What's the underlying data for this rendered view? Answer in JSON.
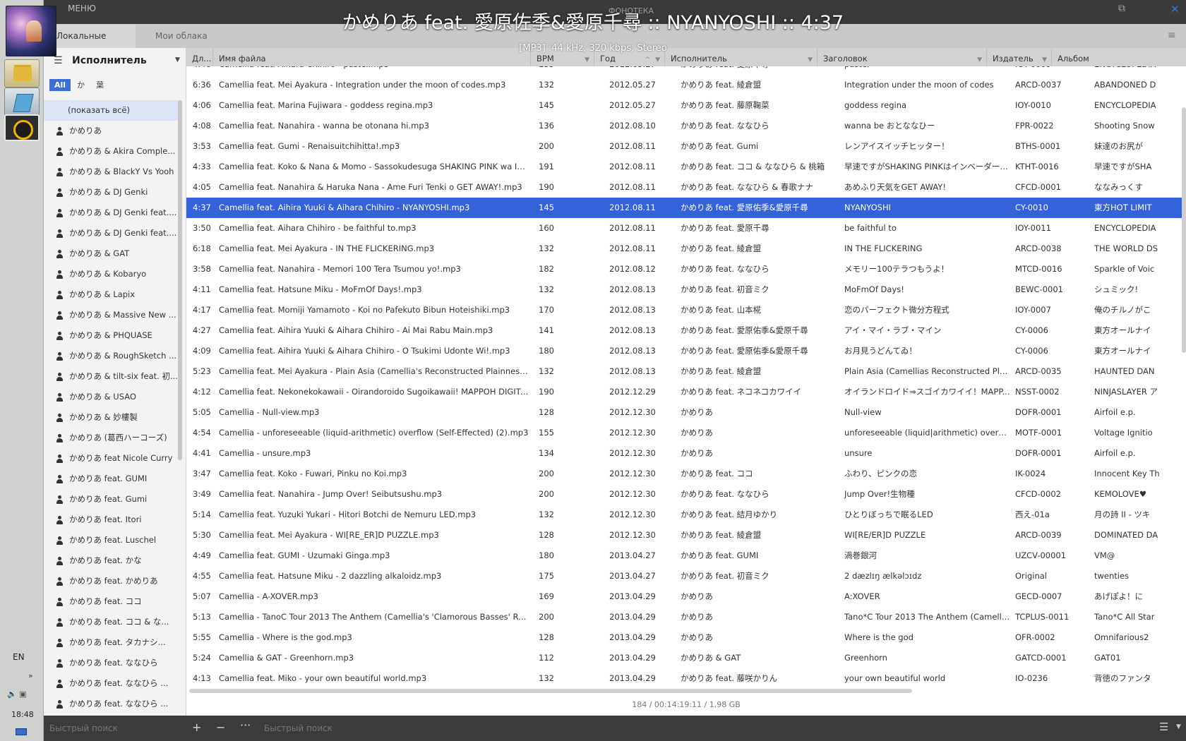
{
  "window": {
    "menu_label": "МЕНЮ",
    "app_title": "ФОНОТЕКА",
    "minimize_glyph": "⧉",
    "close_glyph": "✕"
  },
  "now_playing": {
    "title": "かめりあ feat. 愛原佐季&愛原千尋 :: NYANYOSHI :: 4:37",
    "info": "[MP3] :44 kHz, 320 kbps, Stereo"
  },
  "tabs": [
    {
      "label": "Локальные файлы",
      "active": true
    },
    {
      "label": "Мои облака",
      "active": false
    }
  ],
  "sidebar": {
    "title": "Исполнитель",
    "filters": [
      {
        "label": "All",
        "active": true
      },
      {
        "label": "か",
        "active": false
      },
      {
        "label": "葉",
        "active": false
      }
    ],
    "items": [
      "(показать всё)",
      "かめりあ",
      "かめりあ & Akira Comple...",
      "かめりあ & BlackY Vs Yooh",
      "かめりあ & DJ Genki",
      "かめりあ & DJ Genki feat....",
      "かめりあ & DJ Genki feat....",
      "かめりあ & GAT",
      "かめりあ & Kobaryo",
      "かめりあ & Lapix",
      "かめりあ & Massive New ...",
      "かめりあ & PHQUASE",
      "かめりあ & RoughSketch ...",
      "かめりあ & tilt-six feat. 初...",
      "かめりあ & USAO",
      "かめりあ & 妙樓製",
      "かめりあ (葛西ハーコーズ)",
      "かめりあ feat Nicole Curry",
      "かめりあ feat. GUMI",
      "かめりあ feat. Gumi",
      "かめりあ feat. Itori",
      "かめりあ feat. Luschel",
      "かめりあ feat. かな",
      "かめりあ feat. かめりあ",
      "かめりあ feat. ココ",
      "かめりあ feat. ココ & な...",
      "かめりあ feat. タカナシ...",
      "かめりあ feat. ななひら",
      "かめりあ feat. ななひら ...",
      "かめりあ feat. ななひら ..."
    ]
  },
  "table": {
    "columns": [
      {
        "key": "dur",
        "label": "Дл..."
      },
      {
        "key": "file",
        "label": "Имя файла"
      },
      {
        "key": "bpm",
        "label": "BPM"
      },
      {
        "key": "year",
        "label": "Год"
      },
      {
        "key": "artist",
        "label": "Исполнитель"
      },
      {
        "key": "title",
        "label": "Заголовок"
      },
      {
        "key": "pub",
        "label": "Издатель"
      },
      {
        "key": "album",
        "label": "Альбом"
      }
    ],
    "sort_indicator": "^",
    "filter_glyph": "▼",
    "selected_index": 7,
    "rows": [
      {
        "dur": "4:46",
        "file": "Camellia feat. Aihara Chihiro - pastel.mp3",
        "bpm": "135",
        "year": "2012.05.27",
        "artist": "かめりあ feat. 愛原千尋",
        "title": "pastel",
        "pub": "IOY-0009",
        "album": "ENCYCLOPEDIA"
      },
      {
        "dur": "6:36",
        "file": "Camellia feat. Mei Ayakura - Integration under the moon of codes.mp3",
        "bpm": "132",
        "year": "2012.05.27",
        "artist": "かめりあ feat. 綾倉盟",
        "title": "Integration under the moon of codes",
        "pub": "ARCD-0037",
        "album": "ABANDONED D"
      },
      {
        "dur": "4:06",
        "file": "Camellia feat. Marina Fujiwara - goddess regina.mp3",
        "bpm": "145",
        "year": "2012.05.27",
        "artist": "かめりあ feat. 藤原鞠菜",
        "title": "goddess regina",
        "pub": "IOY-0010",
        "album": "ENCYCLOPEDIA"
      },
      {
        "dur": "4:08",
        "file": "Camellia feat. Nanahira - wanna be otonana hi.mp3",
        "bpm": "136",
        "year": "2012.08.10",
        "artist": "かめりあ feat. ななひら",
        "title": "wanna be おとななひー",
        "pub": "FPR-0022",
        "album": "Shooting Snow"
      },
      {
        "dur": "3:53",
        "file": "Camellia feat. Gumi - Renaisuitchihitta!.mp3",
        "bpm": "200",
        "year": "2012.08.11",
        "artist": "かめりあ feat. Gumi",
        "title": "レンアイスイッチヒッター！",
        "pub": "BTHS-0001",
        "album": "妹達のお尻が"
      },
      {
        "dur": "4:33",
        "file": "Camellia feat. Koko & Nana & Momo - Sassokudesuga SHAKING PINK wa Inbedadatta Yo...",
        "bpm": "191",
        "year": "2012.08.11",
        "artist": "かめりあ feat. ココ & ななひら & 桃箱",
        "title": "早速ですがSHAKING PINKはインベーダーだっ...",
        "pub": "KTHT-0016",
        "album": "早速ですがSHA"
      },
      {
        "dur": "4:05",
        "file": "Camellia feat. Nanahira & Haruka Nana - Ame Furi Tenki o GET AWAY!.mp3",
        "bpm": "190",
        "year": "2012.08.11",
        "artist": "かめりあ feat. ななひら & 春歌ナナ",
        "title": "あめふり天気をGET AWAY!",
        "pub": "CFCD-0001",
        "album": "ななみっくす"
      },
      {
        "dur": "4:37",
        "file": "Camellia feat. Aihira Yuuki & Aihara Chihiro - NYANYOSHI.mp3",
        "bpm": "145",
        "year": "2012.08.11",
        "artist": "かめりあ feat. 愛原佑季&愛原千尋",
        "title": "NYANYOSHI",
        "pub": "CY-0010",
        "album": "東方HOT LIMIT"
      },
      {
        "dur": "3:50",
        "file": "Camellia feat. Aihara Chihiro - be faithful to.mp3",
        "bpm": "160",
        "year": "2012.08.11",
        "artist": "かめりあ feat. 愛原千尋",
        "title": "be faithful to",
        "pub": "IOY-0011",
        "album": "ENCYCLOPEDIA"
      },
      {
        "dur": "6:18",
        "file": "Camellia feat. Mei Ayakura - IN THE FLICKERING.mp3",
        "bpm": "132",
        "year": "2012.08.11",
        "artist": "かめりあ feat. 綾倉盟",
        "title": "IN THE FLICKERING",
        "pub": "ARCD-0038",
        "album": "THE WORLD DS"
      },
      {
        "dur": "3:58",
        "file": "Camellia feat. Nanahira - Memori 100 Tera Tsumou yo!.mp3",
        "bpm": "182",
        "year": "2012.08.12",
        "artist": "かめりあ feat. ななひら",
        "title": "メモリー100テラつもうよ！",
        "pub": "MTCD-0016",
        "album": "Sparkle of Voic"
      },
      {
        "dur": "4:11",
        "file": "Camellia feat. Hatsune Miku - MoFmOf Days!.mp3",
        "bpm": "132",
        "year": "2012.08.13",
        "artist": "かめりあ feat. 初音ミク",
        "title": "MoFmOf Days!",
        "pub": "BEWC-0001",
        "album": "シュミック!"
      },
      {
        "dur": "4:17",
        "file": "Camellia feat. Momiji Yamamoto - Koi no Pafekuto Bibun Hoteishiki.mp3",
        "bpm": "170",
        "year": "2012.08.13",
        "artist": "かめりあ feat. 山本椛",
        "title": "恋のパーフェクト微分方程式",
        "pub": "IOY-0007",
        "album": "俺のチルノがこ"
      },
      {
        "dur": "4:27",
        "file": "Camellia feat. Aihira Yuuki & Aihara Chihiro - Ai Mai Rabu Main.mp3",
        "bpm": "141",
        "year": "2012.08.13",
        "artist": "かめりあ feat. 愛原佑季&愛原千尋",
        "title": "アイ・マイ・ラブ・マイン",
        "pub": "CY-0006",
        "album": "東方オールナイ"
      },
      {
        "dur": "4:09",
        "file": "Camellia feat. Aihira Yuuki & Aihara Chihiro - O Tsukimi Udonte Wi!.mp3",
        "bpm": "180",
        "year": "2012.08.13",
        "artist": "かめりあ feat. 愛原佑季&愛原千尋",
        "title": "お月見うどんてゐ！",
        "pub": "CY-0006",
        "album": "東方オールナイ"
      },
      {
        "dur": "5:23",
        "file": "Camellia feat. Mei Ayakura - Plain Asia (Camellia's Reconstructed Plainness rmx.).mp3",
        "bpm": "132",
        "year": "2012.08.13",
        "artist": "かめりあ feat. 綾倉盟",
        "title": "Plain Asia (Camellias Reconstructed Plainness r...",
        "pub": "ARCD-0035",
        "album": "HAUNTED DAN"
      },
      {
        "dur": "4:12",
        "file": "Camellia feat. Nekonekokawaii - Oirandoroido Sugoikawaii! MAPPOH DIGITAL MEDITEC...",
        "bpm": "190",
        "year": "2012.12.29",
        "artist": "かめりあ feat. ネコネコカワイイ",
        "title": "オイランドロイド⇒スゴイカワイイ！MAPP...",
        "pub": "NSST-0002",
        "album": "NINJASLAYER ア"
      },
      {
        "dur": "5:05",
        "file": "Camellia - Null-view.mp3",
        "bpm": "128",
        "year": "2012.12.30",
        "artist": "かめりあ",
        "title": "Null-view",
        "pub": "DOFR-0001",
        "album": "Airfoil e.p."
      },
      {
        "dur": "4:54",
        "file": "Camellia - unforeseeable (liquid-arithmetic) overflow (Self-Effected) (2).mp3",
        "bpm": "155",
        "year": "2012.12.30",
        "artist": "かめりあ",
        "title": "unforeseeable (liquid|arithmetic) overflow (Self...",
        "pub": "MOTF-0001",
        "album": "Voltage Ignitio"
      },
      {
        "dur": "4:41",
        "file": "Camellia - unsure.mp3",
        "bpm": "134",
        "year": "2012.12.30",
        "artist": "かめりあ",
        "title": "unsure",
        "pub": "DOFR-0001",
        "album": "Airfoil e.p."
      },
      {
        "dur": "3:47",
        "file": "Camellia feat. Koko - Fuwari, Pinku no Koi.mp3",
        "bpm": "200",
        "year": "2012.12.30",
        "artist": "かめりあ feat. ココ",
        "title": "ふわり、ピンクの恋",
        "pub": "IK-0024",
        "album": "Innocent Key Th"
      },
      {
        "dur": "3:49",
        "file": "Camellia feat. Nanahira - Jump Over! Seibutsushu.mp3",
        "bpm": "200",
        "year": "2012.12.30",
        "artist": "かめりあ feat. ななひら",
        "title": "Jump Over!生物種",
        "pub": "CFCD-0002",
        "album": "KEMOLOVE♥"
      },
      {
        "dur": "5:14",
        "file": "Camellia feat. Yuzuki Yukari - Hitori Botchi de Nemuru LED.mp3",
        "bpm": "132",
        "year": "2012.12.30",
        "artist": "かめりあ feat. 結月ゆかり",
        "title": "ひとりぼっちで眠るLED",
        "pub": "西え-01a",
        "album": "月の詩 II - ツキ"
      },
      {
        "dur": "5:30",
        "file": "Camellia feat. Mei Ayakura - WI[RE_ER]D PUZZLE.mp3",
        "bpm": "128",
        "year": "2012.12.30",
        "artist": "かめりあ feat. 綾倉盟",
        "title": "WI[RE/ER]D PUZZLE",
        "pub": "ARCD-0039",
        "album": "DOMINATED DA"
      },
      {
        "dur": "4:49",
        "file": "Camellia feat. GUMI - Uzumaki Ginga.mp3",
        "bpm": "180",
        "year": "2013.04.27",
        "artist": "かめりあ feat. GUMI",
        "title": "渦巻銀河",
        "pub": "UZCV-00001",
        "album": "VM@"
      },
      {
        "dur": "4:55",
        "file": "Camellia feat. Hatsune Miku - 2 dazzling alkaloidz.mp3",
        "bpm": "175",
        "year": "2013.04.27",
        "artist": "かめりあ feat. 初音ミク",
        "title": "2 dæzlɪŋ ælkəlɔɪdz",
        "pub": "Original",
        "album": "twenties"
      },
      {
        "dur": "5:07",
        "file": "Camellia - A-XOVER.mp3",
        "bpm": "169",
        "year": "2013.04.29",
        "artist": "かめりあ",
        "title": "A:XOVER",
        "pub": "GECD-0007",
        "album": "あげぽよ！に"
      },
      {
        "dur": "5:13",
        "file": "Camellia - TanoC Tour 2013 The Anthem (Camellia's 'Clamorous Basses' Remix).mp3",
        "bpm": "200",
        "year": "2013.04.29",
        "artist": "かめりあ",
        "title": "Tano*C Tour 2013 The Anthem (Camellia's Clam...",
        "pub": "TCPLUS-0011",
        "album": "Tano*C All Star"
      },
      {
        "dur": "5:55",
        "file": "Camellia - Where is the god.mp3",
        "bpm": "128",
        "year": "2013.04.29",
        "artist": "かめりあ",
        "title": "Where is the god",
        "pub": "OFR-0002",
        "album": "Omnifarious2"
      },
      {
        "dur": "5:24",
        "file": "Camellia & GAT - Greenhorn.mp3",
        "bpm": "112",
        "year": "2013.04.29",
        "artist": "かめりあ & GAT",
        "title": "Greenhorn",
        "pub": "GATCD-0001",
        "album": "GAT01"
      },
      {
        "dur": "4:13",
        "file": "Camellia feat. Miko - your own beautiful world.mp3",
        "bpm": "132",
        "year": "2013.04.29",
        "artist": "かめりあ feat. 藤咲かりん",
        "title": "your own beautiful world",
        "pub": "IO-0236",
        "album": "背徳のファンタ"
      }
    ],
    "summary": "184 / 00:14:19:11 / 1,98 GB"
  },
  "bottombar": {
    "left_search_placeholder": "Быстрый поиск",
    "right_search_placeholder": "Быстрый поиск",
    "add_glyph": "+",
    "remove_glyph": "−",
    "more_glyph": "···"
  },
  "taskbar": {
    "lang": "EN",
    "chevron_glyph": "»",
    "clock": "18:48"
  }
}
